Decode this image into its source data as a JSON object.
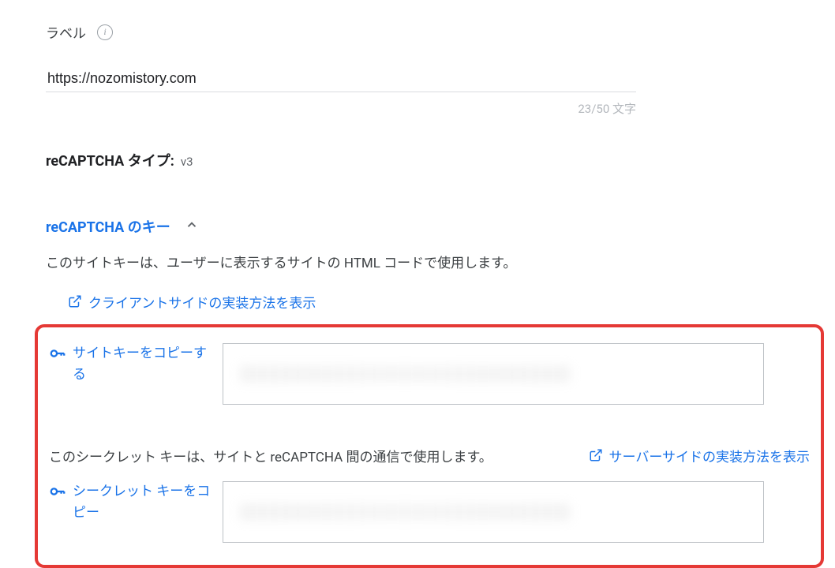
{
  "label": {
    "title": "ラベル",
    "info_icon": "i"
  },
  "url_input": {
    "value": "https://nozomistory.com"
  },
  "char_counter": "23/50 文字",
  "recaptcha_type": {
    "label": "reCAPTCHA タイプ:",
    "value": "v3"
  },
  "keys_section": {
    "title": "reCAPTCHA のキー",
    "site_key_desc": "このサイトキーは、ユーザーに表示するサイトの HTML コードで使用します。",
    "client_link": "クライアントサイドの実装方法を表示",
    "copy_site_key": "サイトキーをコピーする",
    "secret_key_desc": "このシークレット キーは、サイトと reCAPTCHA 間の通信で使用します。",
    "server_link": "サーバーサイドの実装方法を表示",
    "copy_secret_key": "シークレット キーをコピー"
  }
}
